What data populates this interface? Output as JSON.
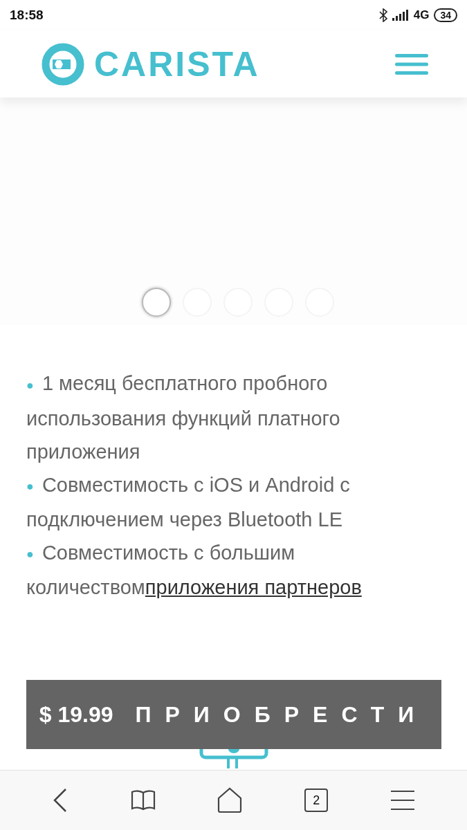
{
  "status_bar": {
    "time": "18:58",
    "network": "4G",
    "battery": "34"
  },
  "header": {
    "logo": "CARISTA"
  },
  "carousel": {
    "dots": [
      {
        "selected": true
      },
      {
        "selected": false
      },
      {
        "selected": false
      },
      {
        "selected": false
      },
      {
        "selected": false
      }
    ]
  },
  "features": [
    {
      "bullet": "●",
      "text": "1 месяц бесплатного пробного использования функций платного приложения"
    },
    {
      "bullet": "●",
      "text": "Совместимость с iOS и Android с подключением через Bluetooth LE"
    },
    {
      "bullet": "●",
      "text": "Совместимость с большим количеством",
      "link": "приложения партнеров"
    }
  ],
  "buy_button": {
    "price": "$ 19.99",
    "label": "ПРИОБРЕСТИ"
  },
  "browser_nav": {
    "tabs_count": "2"
  }
}
